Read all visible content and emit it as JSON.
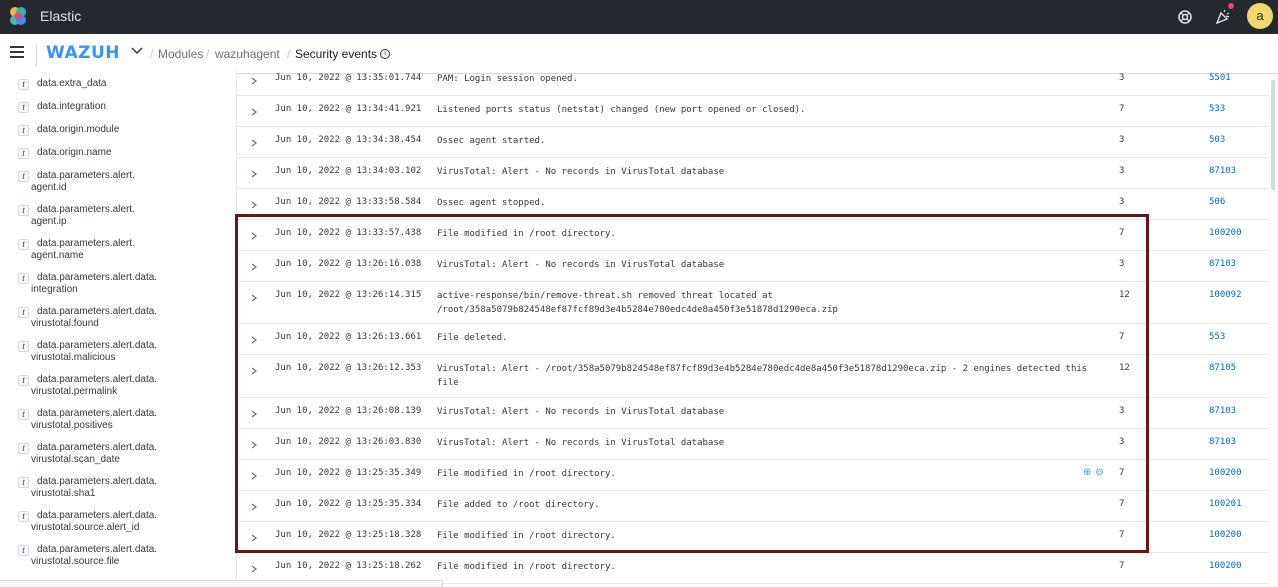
{
  "header": {
    "app_title": "Elastic",
    "avatar_initial": "a",
    "icons": [
      "elastic-logo-icon",
      "help-icon",
      "news-icon"
    ]
  },
  "navbar": {
    "brand": "WAZUH",
    "breadcrumbs": [
      "Modules",
      "wazuhagent"
    ],
    "current": "Security events"
  },
  "sidebar": {
    "fields": [
      {
        "type": "t",
        "name": "data.extra_data"
      },
      {
        "type": "t",
        "name": "data.integration"
      },
      {
        "type": "t",
        "name": "data.origin.module"
      },
      {
        "type": "t",
        "name": "data.origin.name"
      },
      {
        "type": "t",
        "name": "data.parameters.alert.\nagent.id"
      },
      {
        "type": "t",
        "name": "data.parameters.alert.\nagent.ip"
      },
      {
        "type": "t",
        "name": "data.parameters.alert.\nagent.name"
      },
      {
        "type": "t",
        "name": "data.parameters.alert.data.\nintegration"
      },
      {
        "type": "t",
        "name": "data.parameters.alert.data.\nvirustotal.found"
      },
      {
        "type": "t",
        "name": "data.parameters.alert.data.\nvirustotal.malicious"
      },
      {
        "type": "t",
        "name": "data.parameters.alert.data.\nvirustotal.permalink"
      },
      {
        "type": "t",
        "name": "data.parameters.alert.data.\nvirustotal.positives"
      },
      {
        "type": "t",
        "name": "data.parameters.alert.data.\nvirustotal.scan_date"
      },
      {
        "type": "t",
        "name": "data.parameters.alert.data.\nvirustotal.sha1"
      },
      {
        "type": "t",
        "name": "data.parameters.alert.data.\nvirustotal.source.alert_id"
      },
      {
        "type": "t",
        "name": "data.parameters.alert.data.\nvirustotal.source.file"
      }
    ]
  },
  "events": [
    {
      "time": "Jun 10, 2022 @ 13:35:01.744",
      "desc": "PAM: Login session opened.",
      "level": "3",
      "rule": "5501"
    },
    {
      "time": "Jun 10, 2022 @ 13:34:41.921",
      "desc": "Listened ports status (netstat) changed (new port opened or closed).",
      "level": "7",
      "rule": "533"
    },
    {
      "time": "Jun 10, 2022 @ 13:34:38.454",
      "desc": "Ossec agent started.",
      "level": "3",
      "rule": "503"
    },
    {
      "time": "Jun 10, 2022 @ 13:34:03.102",
      "desc": "VirusTotal: Alert - No records in VirusTotal database",
      "level": "3",
      "rule": "87103"
    },
    {
      "time": "Jun 10, 2022 @ 13:33:58.584",
      "desc": "Ossec agent stopped.",
      "level": "3",
      "rule": "506"
    },
    {
      "time": "Jun 10, 2022 @ 13:33:57.438",
      "desc": "File modified in /root directory.",
      "level": "7",
      "rule": "100200"
    },
    {
      "time": "Jun 10, 2022 @ 13:26:16.038",
      "desc": "VirusTotal: Alert - No records in VirusTotal database",
      "level": "3",
      "rule": "87103"
    },
    {
      "time": "Jun 10, 2022 @ 13:26:14.315",
      "desc": "active-response/bin/remove-threat.sh removed threat located at /root/358a5079b824548ef87fcf89d3e4b5284e780edc4de8a450f3e51878d1290eca.zip",
      "level": "12",
      "rule": "100092"
    },
    {
      "time": "Jun 10, 2022 @ 13:26:13.661",
      "desc": "File deleted.",
      "level": "7",
      "rule": "553"
    },
    {
      "time": "Jun 10, 2022 @ 13:26:12.353",
      "desc": "VirusTotal: Alert - /root/358a5079b824548ef87fcf89d3e4b5284e780edc4de8a450f3e51878d1290eca.zip - 2 engines detected this file",
      "level": "12",
      "rule": "87105"
    },
    {
      "time": "Jun 10, 2022 @ 13:26:08.139",
      "desc": "VirusTotal: Alert - No records in VirusTotal database",
      "level": "3",
      "rule": "87103"
    },
    {
      "time": "Jun 10, 2022 @ 13:26:03.830",
      "desc": "VirusTotal: Alert - No records in VirusTotal database",
      "level": "3",
      "rule": "87103"
    },
    {
      "time": "Jun 10, 2022 @ 13:25:35.349",
      "desc": "File modified in /root directory.",
      "level": "7",
      "rule": "100200"
    },
    {
      "time": "Jun 10, 2022 @ 13:25:35.334",
      "desc": "File added to /root directory.",
      "level": "7",
      "rule": "100201"
    },
    {
      "time": "Jun 10, 2022 @ 13:25:18.328",
      "desc": "File modified in /root directory.",
      "level": "7",
      "rule": "100200"
    },
    {
      "time": "Jun 10, 2022 @ 13:25:18.262",
      "desc": "File modified in /root directory.",
      "level": "7",
      "rule": "100200"
    }
  ],
  "row_actions": {
    "filter_in": "⊕",
    "filter_out": "⊖"
  },
  "colors": {
    "highlight": "#6b1518",
    "link": "#006bb4",
    "brand": "#3595f9"
  }
}
